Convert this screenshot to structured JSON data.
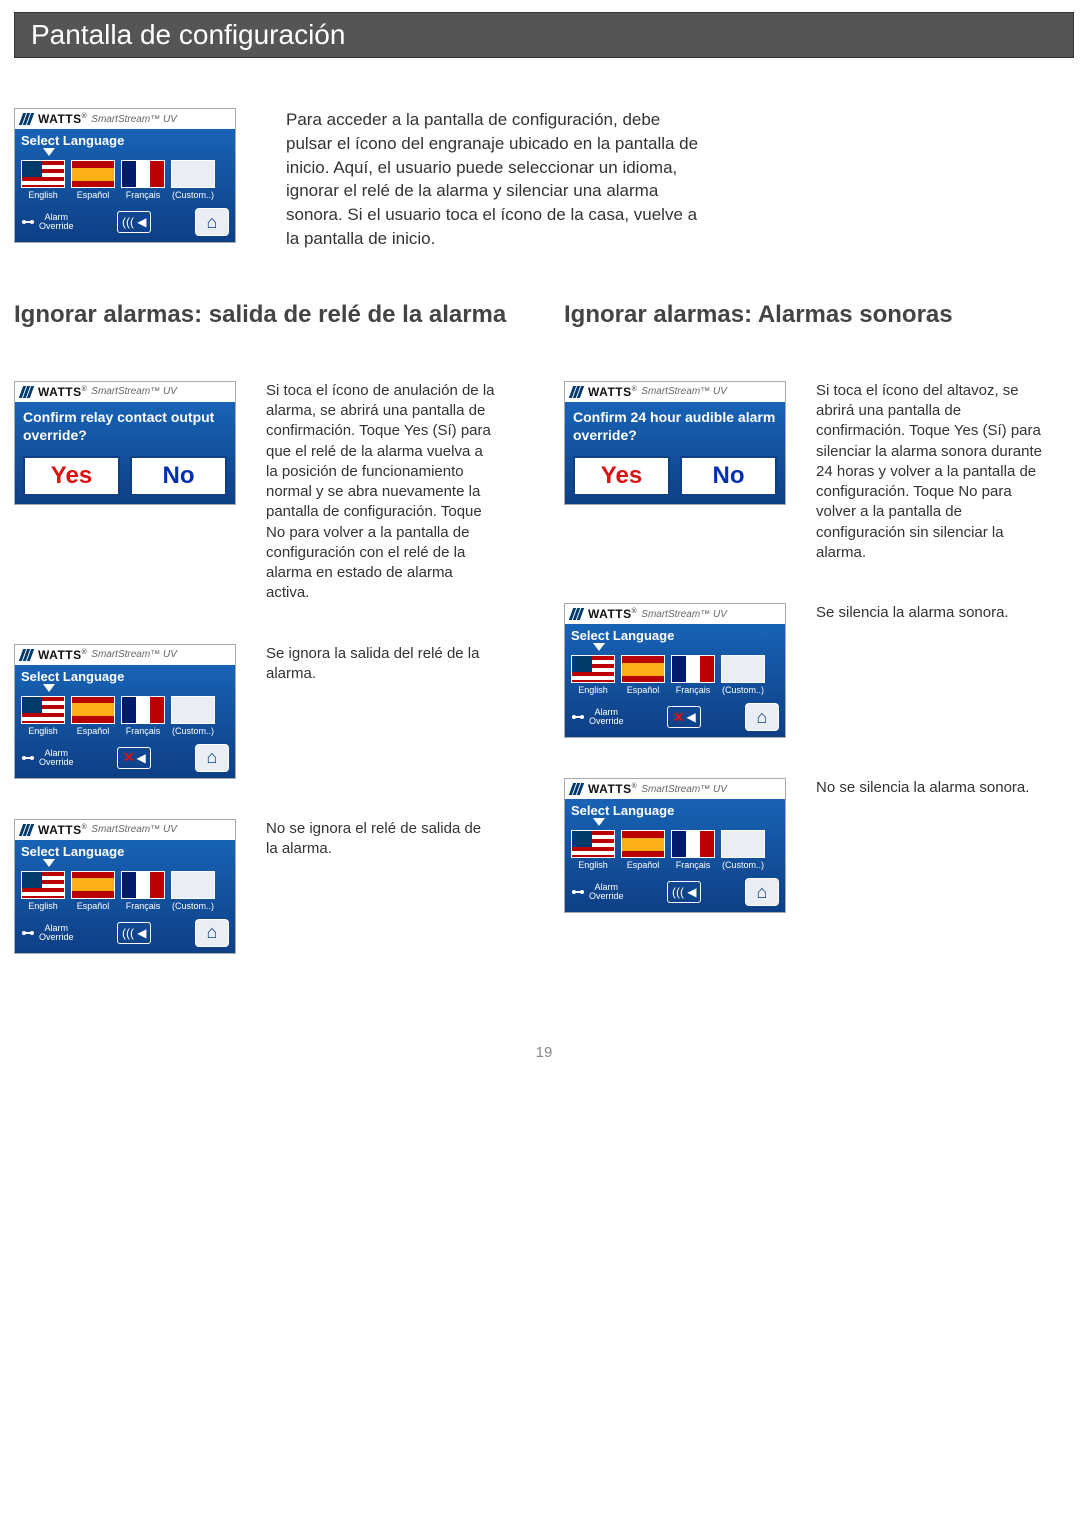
{
  "pageTitle": "Pantalla de configuración",
  "brand": {
    "name": "WATTS",
    "reg": "®",
    "sub1": "SmartStream",
    "sub2": "™ UV"
  },
  "ui": {
    "selectLanguage": "Select Language",
    "langs": [
      "English",
      "Español",
      "Français",
      "(Custom..)"
    ],
    "alarmOverride": "Alarm\nOverride",
    "yes": "Yes",
    "no": "No",
    "confirmRelay": "Confirm relay contact output override?",
    "confirmAudible": "Confirm 24 hour audible alarm override?"
  },
  "intro": "Para acceder a la pantalla de configuración, debe pulsar el ícono del engranaje ubicado en la pantalla de inicio. Aquí, el usuario puede seleccionar un idioma, ignorar el relé de la alarma y silenciar una alarma sonora. Si el usuario toca el ícono de la casa, vuelve a la pantalla de inicio.",
  "colA": {
    "heading": "Ignorar alarmas: salida de relé de la alarma",
    "p1": "Si toca el ícono de anulación de la alarma, se abrirá una pantalla de confirmación. Toque Yes (Sí) para que el relé de la alarma vuelva a la posición de funcionamiento normal y se abra nuevamente la pantalla de configuración. Toque No para volver a la pantalla de configuración con el relé de la alarma en estado de alarma activa.",
    "p2": "Se ignora la salida del relé de la alarma.",
    "p3": "No se ignora el relé de salida de la alarma."
  },
  "colB": {
    "heading": "Ignorar alarmas: Alarmas sonoras",
    "p1": "Si toca el ícono del altavoz, se abrirá una pantalla de confirmación. Toque Yes (Sí) para silenciar la alarma sonora durante 24 horas y volver a la pantalla de configuración. Toque No para volver a la pantalla de configuración sin silenciar la alarma.",
    "p2": "Se silencia la alarma sonora.",
    "p3": "No se silencia la alarma sonora."
  },
  "pageNumber": "19"
}
